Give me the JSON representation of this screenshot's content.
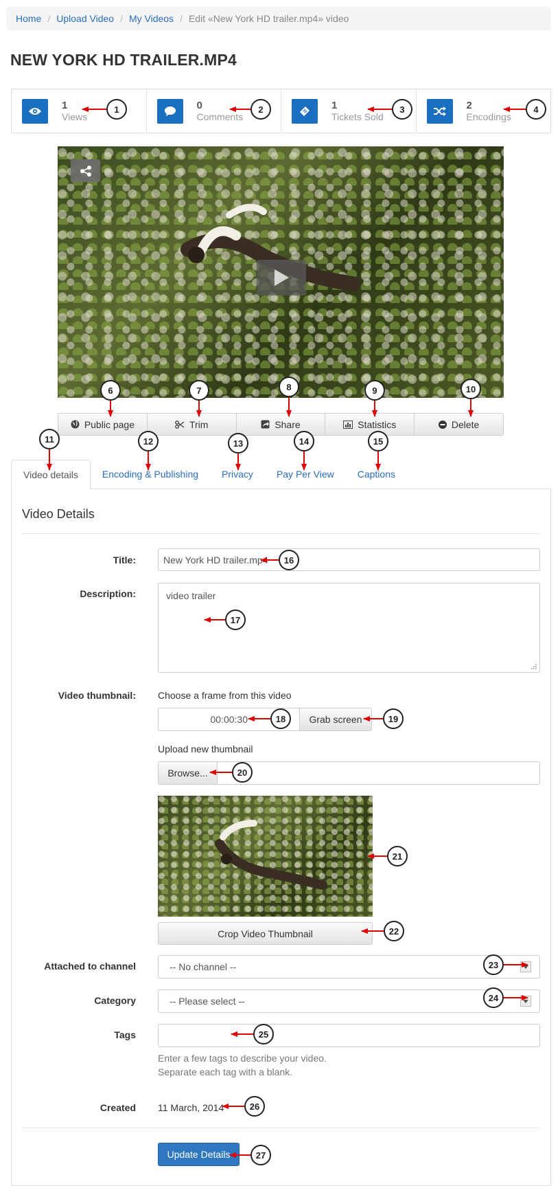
{
  "breadcrumb": {
    "home": "Home",
    "upload": "Upload Video",
    "my_videos": "My Videos",
    "current": "Edit «New York HD trailer.mp4» video"
  },
  "page_title": "NEW YORK HD TRAILER.MP4",
  "stats": [
    {
      "value": "1",
      "label": "Views",
      "icon": "eye-icon"
    },
    {
      "value": "0",
      "label": "Comments",
      "icon": "comment-icon"
    },
    {
      "value": "1",
      "label": "Tickets Sold",
      "icon": "ticket-icon"
    },
    {
      "value": "2",
      "label": "Encodings",
      "icon": "shuffle-icon"
    }
  ],
  "actions": {
    "public_page": "Public page",
    "trim": "Trim",
    "share": "Share",
    "statistics": "Statistics",
    "delete": "Delete"
  },
  "tabs": {
    "video_details": "Video details",
    "encoding": "Encoding & Publishing",
    "privacy": "Privacy",
    "ppv": "Pay Per View",
    "captions": "Captions"
  },
  "form": {
    "heading": "Video Details",
    "title_label": "Title:",
    "title_value": "New York HD trailer.mp4",
    "description_label": "Description:",
    "description_value": "video trailer",
    "thumbnail_label": "Video thumbnail:",
    "choose_frame": "Choose a frame from this video",
    "time_value": "00:00:30",
    "grab_screen": "Grab screen",
    "upload_new": "Upload new thumbnail",
    "browse": "Browse...",
    "crop": "Crop Video Thumbnail",
    "channel_label": "Attached to channel",
    "channel_value": "-- No channel --",
    "category_label": "Category",
    "category_value": "-- Please select --",
    "tags_label": "Tags",
    "tags_help_1": "Enter a few tags to describe your video.",
    "tags_help_2": "Separate each tag with a blank.",
    "created_label": "Created",
    "created_value": "11 March, 2014",
    "update": "Update Details"
  },
  "callouts": [
    "1",
    "2",
    "3",
    "4",
    "6",
    "7",
    "8",
    "9",
    "10",
    "11",
    "12",
    "13",
    "14",
    "15",
    "16",
    "17",
    "18",
    "19",
    "20",
    "21",
    "22",
    "23",
    "24",
    "25",
    "26",
    "27"
  ],
  "colors": {
    "accent": "#1b6fc1",
    "link": "#2a6ebb",
    "arrow": "#e00000",
    "primary": "#2f77c0"
  }
}
